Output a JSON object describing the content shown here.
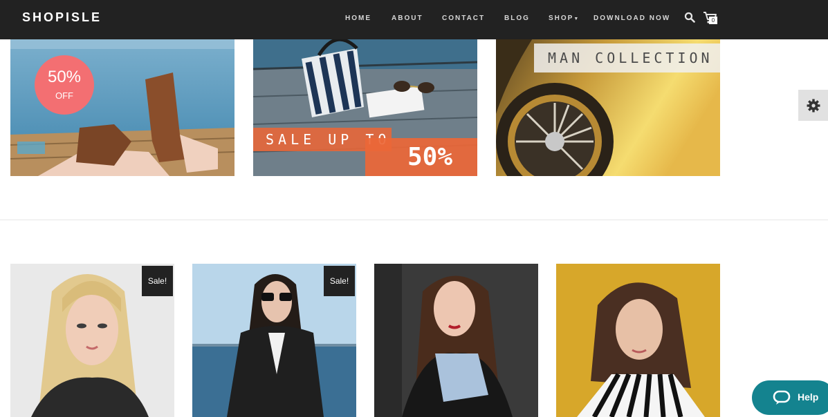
{
  "header": {
    "brand": "SHOPISLE",
    "nav": {
      "home": "HOME",
      "about": "ABOUT",
      "contact": "CONTACT",
      "blog": "BLOG",
      "shop": "SHOP",
      "download": "DOWNLOAD NOW"
    },
    "cart_count": "0",
    "icons": [
      "search-icon",
      "cart-icon",
      "caret-down-icon"
    ]
  },
  "banners": {
    "first": {
      "badge_big": "50%",
      "badge_small": "OFF"
    },
    "second": {
      "sale_text": "SALE UP TO",
      "sale_percent": "50%"
    },
    "third": {
      "label": "MAN COLLECTION"
    }
  },
  "products": {
    "badges": {
      "p1": "Sale!",
      "p2": "Sale!"
    }
  },
  "widgets": {
    "settings_icon": "gear-icon",
    "help_label": "Help",
    "help_icon": "chat-bubble-icon"
  },
  "colors": {
    "header_bg": "#222222",
    "badge_red": "#f36f72",
    "sale_orange": "#eb6737",
    "help_teal": "#14838f"
  }
}
